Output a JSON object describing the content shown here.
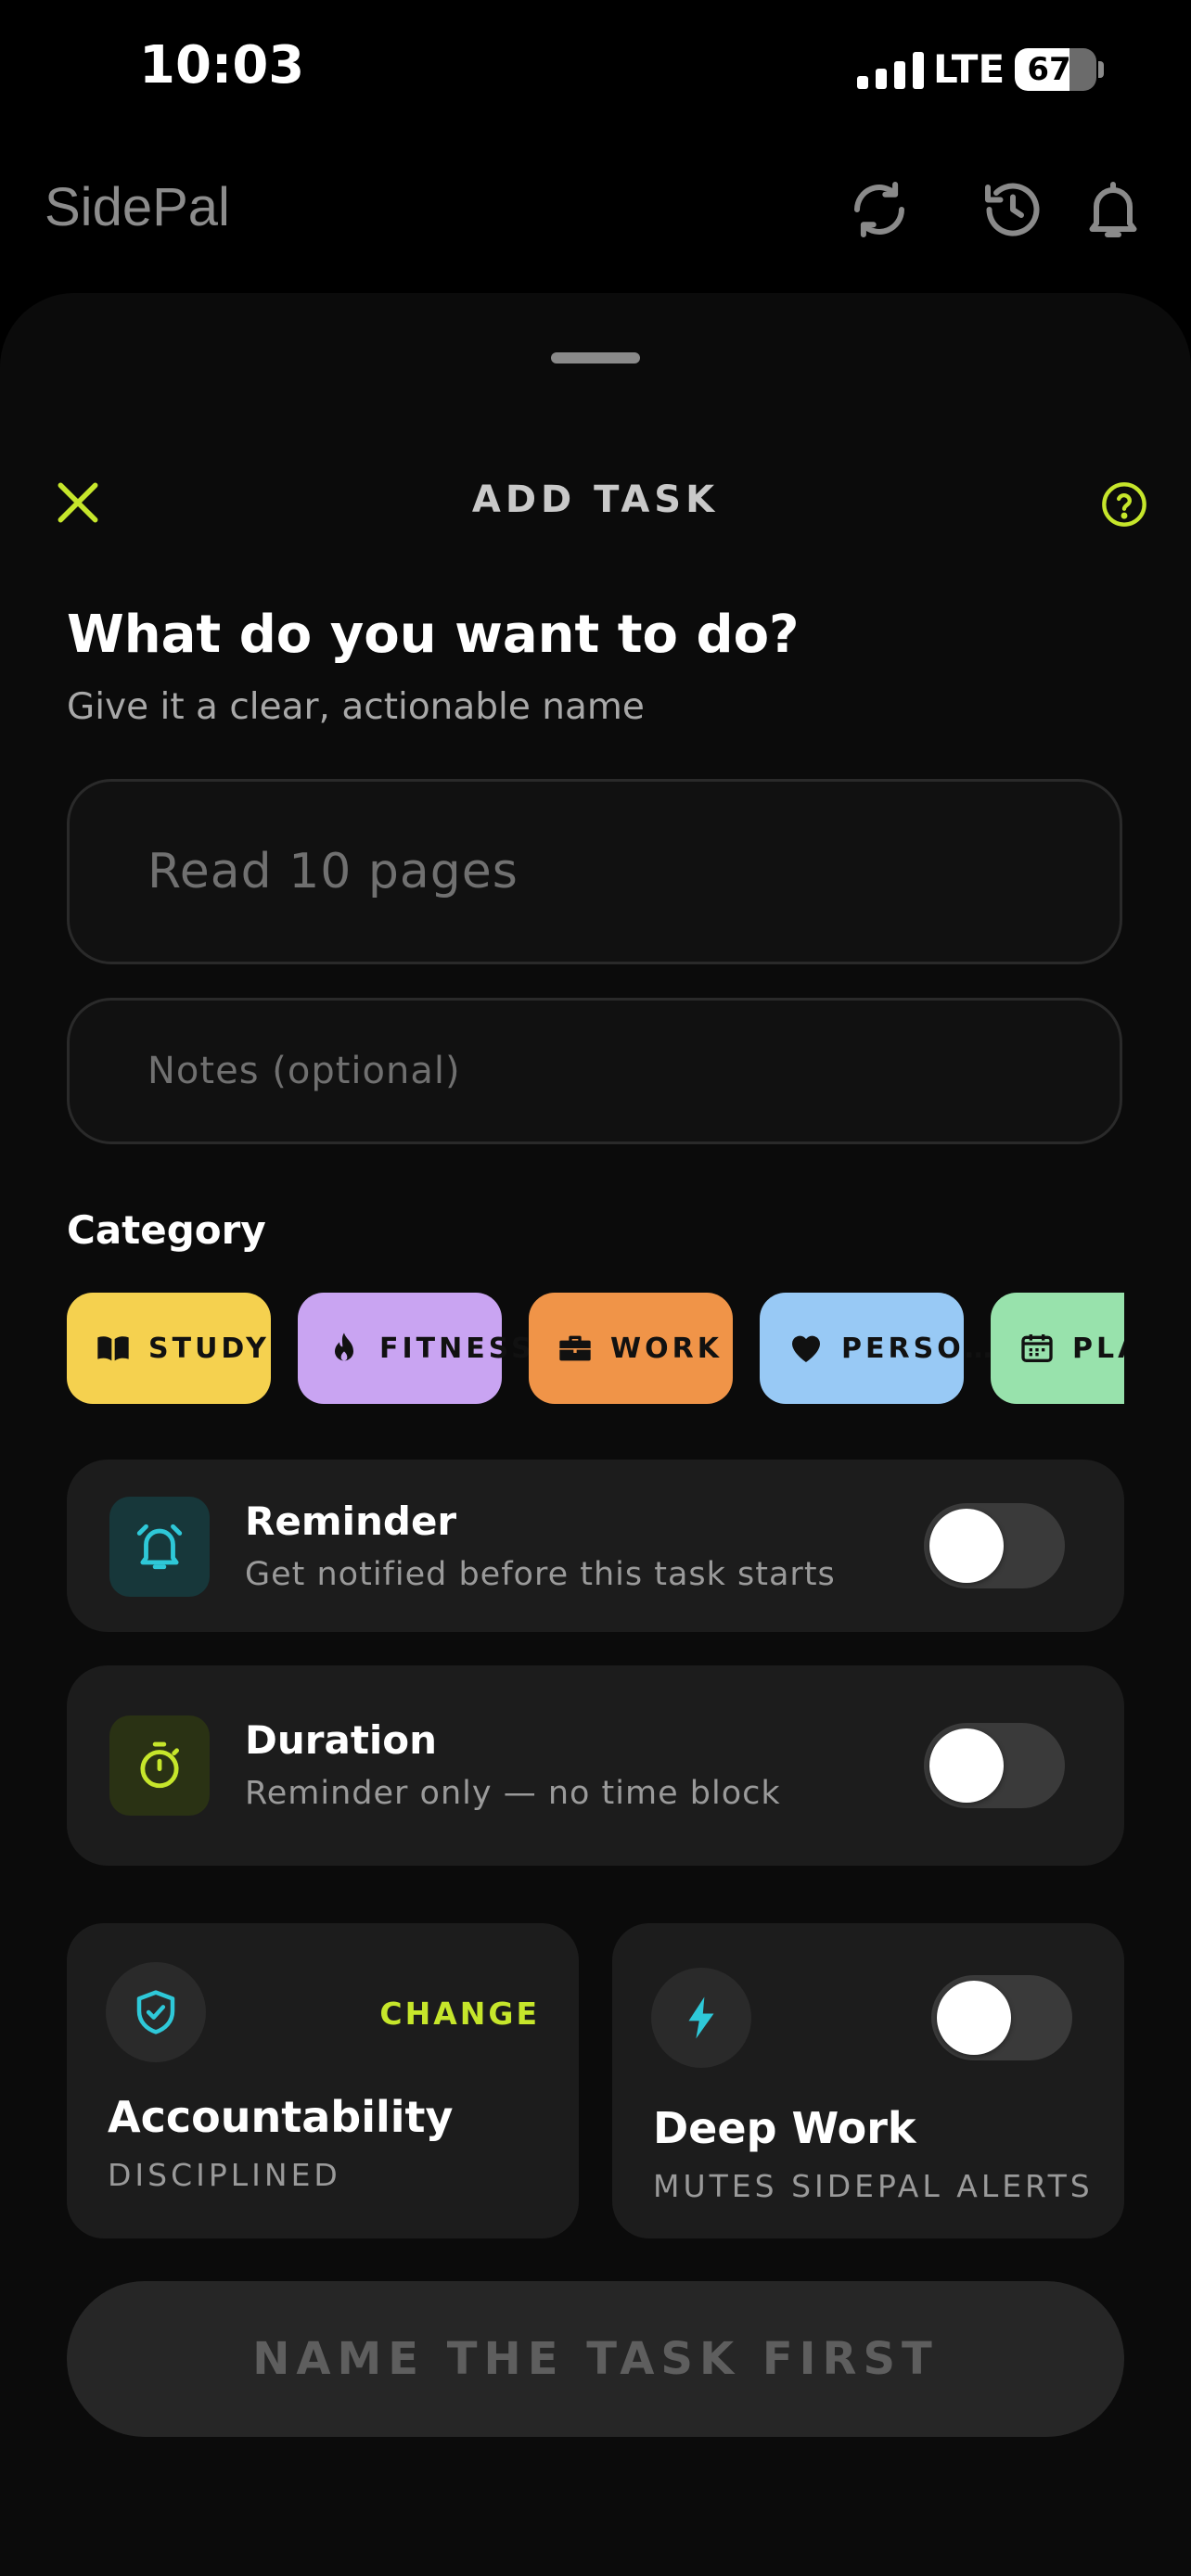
{
  "status_bar": {
    "time": "10:03",
    "network": "LTE",
    "battery": "67",
    "battery_level": 0.67
  },
  "app": {
    "title": "SidePal",
    "icons": [
      "sync-icon",
      "history-icon",
      "bell-icon"
    ]
  },
  "sheet": {
    "title": "ADD TASK",
    "heading": "What do you want to do?",
    "subheading": "Give it a clear, actionable name",
    "task_placeholder": "Read 10 pages",
    "notes_placeholder": "Notes (optional)"
  },
  "category": {
    "label": "Category",
    "chips": [
      {
        "label": "STUDY",
        "color": "#f5d14f",
        "icon": "book-icon"
      },
      {
        "label": "FITNESS",
        "color": "#c9a4f2",
        "icon": "flame-icon"
      },
      {
        "label": "WORK",
        "color": "#f09448",
        "icon": "briefcase-icon"
      },
      {
        "label": "PERSO…",
        "color": "#98c9f5",
        "icon": "heart-icon"
      },
      {
        "label": "PLA",
        "color": "#98e2ac",
        "icon": "calendar-icon"
      }
    ]
  },
  "reminder": {
    "title": "Reminder",
    "subtitle": "Get notified before this task starts",
    "enabled": false,
    "icon_color": "#2ec8d8"
  },
  "duration": {
    "title": "Duration",
    "subtitle": "Reminder only — no time block",
    "enabled": false,
    "icon_color": "#c6e62b"
  },
  "accountability": {
    "title": "Accountability",
    "subtitle": "DISCIPLINED",
    "action": "CHANGE"
  },
  "deep_work": {
    "title": "Deep Work",
    "subtitle": "MUTES SIDEPAL ALERTS",
    "enabled": false
  },
  "cta": {
    "label": "NAME THE TASK FIRST"
  },
  "colors": {
    "accent": "#c6e62b",
    "background": "#000000",
    "sheet": "#0b0b0b",
    "card": "#1c1c1c"
  }
}
